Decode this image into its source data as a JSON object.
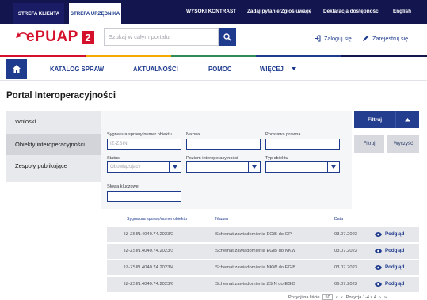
{
  "topbar": {
    "tab_klienta": "STREFA KLIENTA",
    "tab_urzednika": "STREFA URZĘDNIKA",
    "links": [
      "WYSOKI KONTRAST",
      "Zadaj pytanie/Zgłoś uwagę",
      "Deklaracja dostępności",
      "English"
    ]
  },
  "header": {
    "logo_text": "ePUAP",
    "logo_version": "2",
    "search_placeholder": "Szukaj w całym portalu",
    "login_label": "Zaloguj się",
    "register_label": "Zarejestruj się"
  },
  "nav": {
    "items": [
      "KATALOG SPRAW",
      "AKTUALNOŚCI",
      "POMOC",
      "WIĘCEJ"
    ]
  },
  "page": {
    "title": "Portal Interoperacyjności"
  },
  "sidebar": {
    "items": [
      "Wnioski",
      "Obiekty interoperacyjności",
      "Zespoły publikujące"
    ],
    "active_index": 1
  },
  "filters": {
    "sygnatura_label": "Sygnatura sprawy/numer obiektu",
    "sygnatura_value": "IZ-ZSIN",
    "nazwa_label": "Nazwa",
    "nazwa_value": "",
    "podstawa_label": "Podstawa prawna",
    "podstawa_value": "",
    "status_label": "Status",
    "status_value": "Obowiązujący",
    "poziom_label": "Poziom interoperacyjności",
    "poziom_value": "",
    "typ_label": "Typ obiektu",
    "typ_value": "",
    "slowa_label": "Słowa kluczowe",
    "slowa_value": "",
    "toggle_label": "Filtruj",
    "apply_label": "Filtruj",
    "clear_label": "Wyczyść"
  },
  "table": {
    "headers": [
      "Sygnatura sprawy/numer obiektu",
      "Nazwa",
      "Data"
    ],
    "action_label": "Podgląd",
    "rows": [
      {
        "sygnatura": "IZ-ZSIN.4040.74.2023/2",
        "nazwa": "Schemat zawiadomienia EGiB do OP",
        "data": "03.07.2023"
      },
      {
        "sygnatura": "IZ-ZSIN.4040.74.2023/3",
        "nazwa": "Schemat zawiadomienia EGiB do NKW",
        "data": "03.07.2023"
      },
      {
        "sygnatura": "IZ-ZSIN.4040.74.2023/4",
        "nazwa": "Schemat zawiadomienia NKW do EGiB",
        "data": "03.07.2023"
      },
      {
        "sygnatura": "IZ-ZSIN.4040.74.2023/6",
        "nazwa": "Schemat zawiadomienia ZSIN do EGiB",
        "data": "06.07.2023"
      }
    ]
  },
  "pager": {
    "per_page_label": "Pozycji na liście",
    "per_page_value": "50",
    "page_text": "Pozycja 1-4 z 4"
  },
  "colors": {
    "navy": "#13154f",
    "accent_blue": "#1f3b8e",
    "brand_red": "#d4102b",
    "stripe": [
      "#d4102b",
      "#f2a900",
      "#2e8b57",
      "#1f3b8e",
      "#13154f"
    ]
  }
}
